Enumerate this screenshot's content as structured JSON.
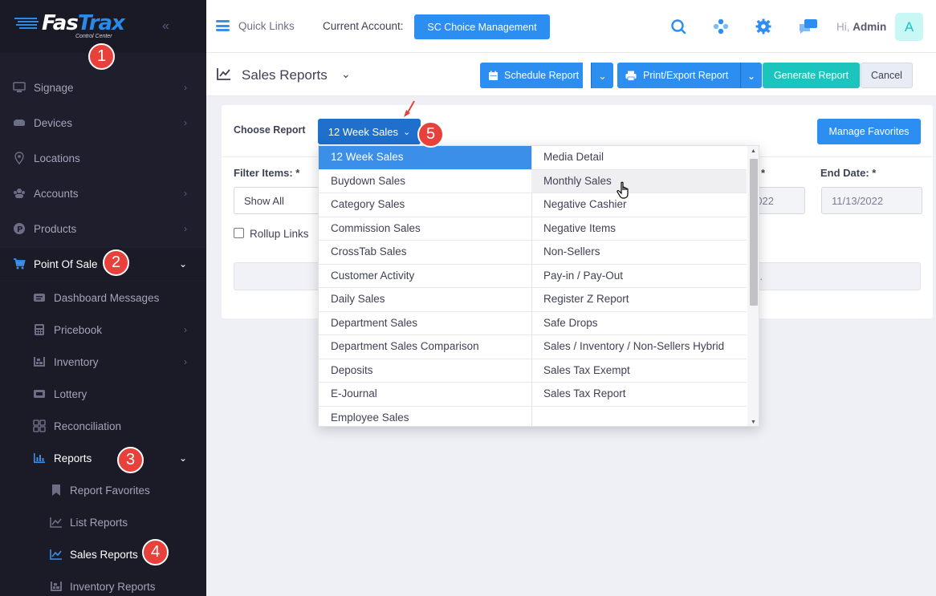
{
  "sidebar": {
    "brand": "FasTrax",
    "brand_sub": "Control Center",
    "items": [
      {
        "label": "Signage",
        "icon": "monitor-icon"
      },
      {
        "label": "Devices",
        "icon": "hard-drive-icon"
      },
      {
        "label": "Locations",
        "icon": "map-pin-icon"
      },
      {
        "label": "Accounts",
        "icon": "users-icon"
      },
      {
        "label": "Products",
        "icon": "product-icon"
      },
      {
        "label": "Point Of Sale",
        "icon": "cart-icon"
      },
      {
        "label": "Dashboard Messages",
        "icon": "message-icon"
      },
      {
        "label": "Pricebook",
        "icon": "calculator-icon"
      },
      {
        "label": "Inventory",
        "icon": "inventory-icon"
      },
      {
        "label": "Lottery",
        "icon": "ticket-icon"
      },
      {
        "label": "Reconciliation",
        "icon": "grid-icon"
      },
      {
        "label": "Reports",
        "icon": "bar-chart-icon"
      },
      {
        "label": "Report Favorites",
        "icon": "bookmark-icon"
      },
      {
        "label": "List Reports",
        "icon": "line-chart-icon"
      },
      {
        "label": "Sales Reports",
        "icon": "line-chart-icon"
      },
      {
        "label": "Inventory Reports",
        "icon": "inventory-icon"
      }
    ]
  },
  "annotations": [
    "1",
    "2",
    "3",
    "4",
    "5"
  ],
  "topbar": {
    "quick_links": "Quick Links",
    "current_account_label": "Current Account:",
    "account_name": "SC Choice Management",
    "greeting_hi": "Hi,",
    "greeting_name": "Admin",
    "avatar_letter": "A"
  },
  "subheader": {
    "title": "Sales Reports",
    "schedule": "Schedule Report",
    "print_export": "Print/Export Report",
    "generate": "Generate Report",
    "cancel": "Cancel"
  },
  "form": {
    "choose_report_label": "Choose Report",
    "selected_report": "12 Week Sales",
    "manage_favorites": "Manage Favorites",
    "filter_items_label": "Filter Items: *",
    "filter_value": "Show All",
    "start_date_label_suffix": "*",
    "start_date_partial": "022",
    "end_date_label": "End Date: *",
    "end_date": "11/13/2022",
    "rollup_label": "Rollup Links",
    "info_partial": "s."
  },
  "dropdown": {
    "left": [
      "12 Week Sales",
      "Buydown Sales",
      "Category Sales",
      "Commission Sales",
      "CrossTab Sales",
      "Customer Activity",
      "Daily Sales",
      "Department Sales",
      "Department Sales Comparison",
      "Deposits",
      "E-Journal",
      "Employee Sales"
    ],
    "right": [
      "Media Detail",
      "Monthly Sales",
      "Negative Cashier",
      "Negative Items",
      "Non-Sellers",
      "Pay-in / Pay-Out",
      "Register Z Report",
      "Safe Drops",
      "Sales / Inventory / Non-Sellers Hybrid",
      "Sales Tax Exempt",
      "Sales Tax Report"
    ]
  },
  "colors": {
    "primary": "#2b8ef0",
    "green": "#1bc5bd",
    "sidebar": "#1e1e2d",
    "badge": "#e8413b"
  }
}
